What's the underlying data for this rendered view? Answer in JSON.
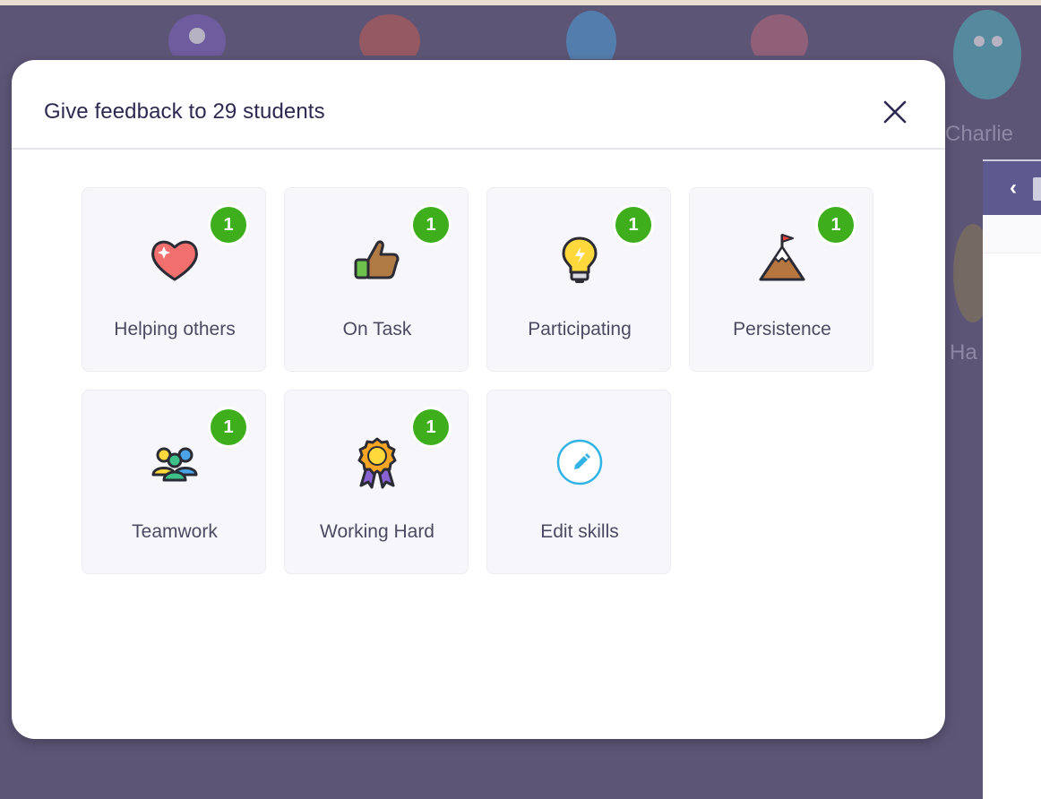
{
  "modal": {
    "title": "Give feedback to 29 students",
    "close_icon": "close-icon"
  },
  "skills": [
    {
      "label": "Helping others",
      "icon": "heart-icon",
      "count": "1"
    },
    {
      "label": "On Task",
      "icon": "thumbs-up-icon",
      "count": "1"
    },
    {
      "label": "Participating",
      "icon": "lightbulb-icon",
      "count": "1"
    },
    {
      "label": "Persistence",
      "icon": "mountain-flag-icon",
      "count": "1"
    },
    {
      "label": "Teamwork",
      "icon": "team-icon",
      "count": "1"
    },
    {
      "label": "Working Hard",
      "icon": "medal-icon",
      "count": "1"
    }
  ],
  "edit_skills": {
    "label": "Edit skills",
    "icon": "pencil-icon"
  },
  "background": {
    "visible_names": [
      "Charlie",
      "Ha"
    ],
    "panel_back_icon": "chevron-left-icon"
  },
  "colors": {
    "badge": "#3fae1c",
    "accent": "#32b3e5",
    "overlay": "#5d5576"
  }
}
